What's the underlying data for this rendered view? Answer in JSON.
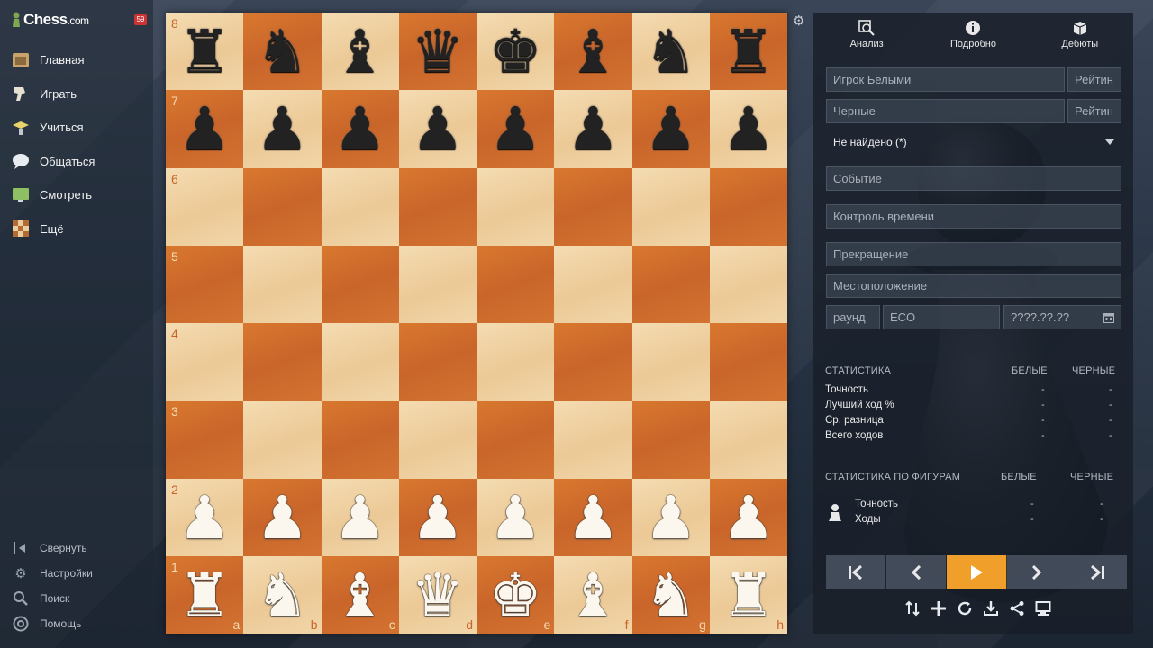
{
  "app": {
    "logo_text": "Chess",
    "logo_suffix": ".com",
    "notification_count": "59"
  },
  "sidebar": {
    "items": [
      {
        "label": "Главная",
        "icon": "home-icon"
      },
      {
        "label": "Играть",
        "icon": "play-icon"
      },
      {
        "label": "Учиться",
        "icon": "learn-icon"
      },
      {
        "label": "Общаться",
        "icon": "social-icon"
      },
      {
        "label": "Смотреть",
        "icon": "watch-icon"
      },
      {
        "label": "Ещё",
        "icon": "more-icon"
      }
    ],
    "bottom_items": [
      {
        "label": "Свернуть",
        "icon": "collapse-icon"
      },
      {
        "label": "Настройки",
        "icon": "settings-icon"
      },
      {
        "label": "Поиск",
        "icon": "search-icon"
      },
      {
        "label": "Помощь",
        "icon": "help-icon"
      }
    ]
  },
  "board": {
    "ranks": [
      "8",
      "7",
      "6",
      "5",
      "4",
      "3",
      "2",
      "1"
    ],
    "files": [
      "a",
      "b",
      "c",
      "d",
      "e",
      "f",
      "g",
      "h"
    ],
    "position": [
      [
        "bR",
        "bN",
        "bB",
        "bQ",
        "bK",
        "bB",
        "bN",
        "bR"
      ],
      [
        "bP",
        "bP",
        "bP",
        "bP",
        "bP",
        "bP",
        "bP",
        "bP"
      ],
      [
        "",
        "",
        "",
        "",
        "",
        "",
        "",
        ""
      ],
      [
        "",
        "",
        "",
        "",
        "",
        "",
        "",
        ""
      ],
      [
        "",
        "",
        "",
        "",
        "",
        "",
        "",
        ""
      ],
      [
        "",
        "",
        "",
        "",
        "",
        "",
        "",
        ""
      ],
      [
        "wP",
        "wP",
        "wP",
        "wP",
        "wP",
        "wP",
        "wP",
        "wP"
      ],
      [
        "wR",
        "wN",
        "wB",
        "wQ",
        "wK",
        "wB",
        "wN",
        "wR"
      ]
    ],
    "colors": {
      "light": "#f4dcb2",
      "dark": "#d06e2e"
    }
  },
  "panel": {
    "tabs": [
      {
        "label": "Анализ",
        "icon": "analysis-icon"
      },
      {
        "label": "Подробно",
        "icon": "info-icon"
      },
      {
        "label": "Дебюты",
        "icon": "openings-icon"
      }
    ],
    "fields": {
      "white_player": "Игрок Белыми",
      "white_rating": "Рейтин",
      "black_player": "Черные",
      "black_rating": "Рейтин",
      "result": "Не найдено (*)",
      "event": "Событие",
      "time_control": "Контроль времени",
      "termination": "Прекращение",
      "location": "Местоположение",
      "round": "раунд",
      "eco": "ECO",
      "date": "????.??.??"
    },
    "stats": {
      "title": "СТАТИСТИКА",
      "col_white": "БЕЛЫЕ",
      "col_black": "ЧЕРНЫЕ",
      "rows": [
        {
          "label": "Точность",
          "white": "-",
          "black": "-"
        },
        {
          "label": "Лучший ход %",
          "white": "-",
          "black": "-"
        },
        {
          "label": "Ср. разница",
          "white": "-",
          "black": "-"
        },
        {
          "label": "Всего ходов",
          "white": "-",
          "black": "-"
        }
      ]
    },
    "piece_stats": {
      "title": "СТАТИСТИКА ПО ФИГУРАМ",
      "col_white": "БЕЛЫЕ",
      "col_black": "ЧЕРНЫЕ",
      "rows": [
        {
          "label": "Точность",
          "white": "-",
          "black": "-"
        },
        {
          "label": "Ходы",
          "white": "-",
          "black": "-"
        }
      ]
    },
    "accent": "#f0a02a"
  }
}
